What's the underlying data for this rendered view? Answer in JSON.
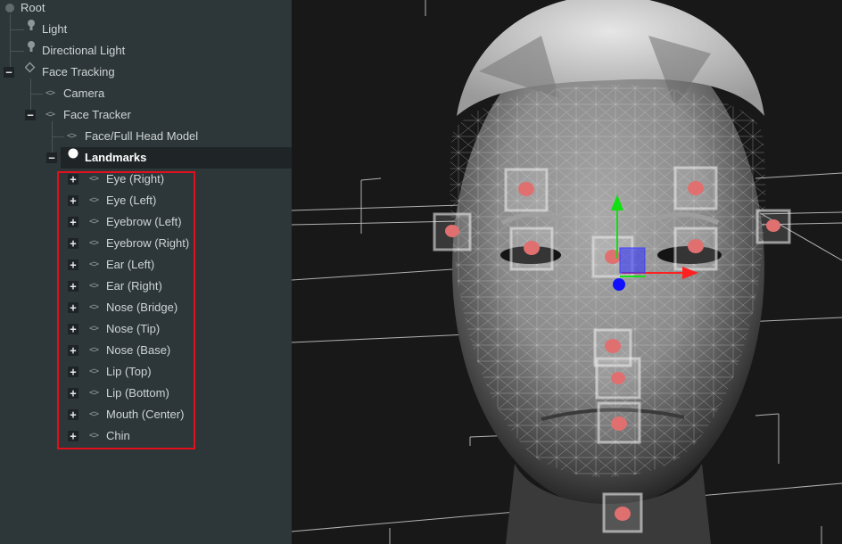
{
  "scene_tree": {
    "root": {
      "label": "Root",
      "icon": "root-dot-icon"
    },
    "light": {
      "label": "Light",
      "icon": "light-icon"
    },
    "directional_light": {
      "label": "Directional Light",
      "icon": "light-icon"
    },
    "face_tracking": {
      "label": "Face Tracking",
      "toggle": "−",
      "icon": "face-tracking-icon"
    },
    "camera": {
      "label": "Camera",
      "icon": "code-tag-icon"
    },
    "face_tracker": {
      "label": "Face Tracker",
      "toggle": "−",
      "icon": "code-tag-icon"
    },
    "face_model": {
      "label": "Face/Full Head Model",
      "icon": "code-tag-icon"
    },
    "landmarks": {
      "label": "Landmarks",
      "toggle": "−",
      "icon": "white-dot-icon",
      "selected": true
    },
    "landmark_items": [
      {
        "label": "Eye (Right)",
        "toggle": "+"
      },
      {
        "label": "Eye (Left)",
        "toggle": "+"
      },
      {
        "label": "Eyebrow (Left)",
        "toggle": "+"
      },
      {
        "label": "Eyebrow (Right)",
        "toggle": "+"
      },
      {
        "label": "Ear (Left)",
        "toggle": "+"
      },
      {
        "label": "Ear (Right)",
        "toggle": "+"
      },
      {
        "label": "Nose (Bridge)",
        "toggle": "+"
      },
      {
        "label": "Nose (Tip)",
        "toggle": "+"
      },
      {
        "label": "Nose (Base)",
        "toggle": "+"
      },
      {
        "label": "Lip (Top)",
        "toggle": "+"
      },
      {
        "label": "Lip (Bottom)",
        "toggle": "+"
      },
      {
        "label": "Mouth (Center)",
        "toggle": "+"
      },
      {
        "label": "Chin",
        "toggle": "+"
      }
    ]
  },
  "colors": {
    "panel_bg": "#2d3638",
    "selected_row_bg": "#1f2527",
    "highlight_border": "#e0101c",
    "viewport_bg": "#181818",
    "landmark_marker": "#e07070",
    "gizmo_x": "#ff2020",
    "gizmo_y": "#10e010",
    "gizmo_z": "#1010ff"
  }
}
